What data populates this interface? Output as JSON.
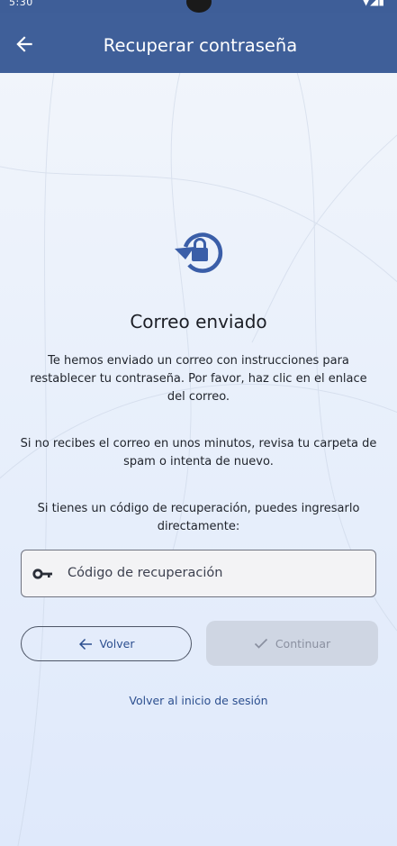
{
  "status_bar": {
    "time": "5:30",
    "icons": [
      "notification-icon",
      "location-icon",
      "shield-icon",
      "wifi-icon",
      "signal-icon",
      "battery-icon"
    ]
  },
  "app_bar": {
    "title": "Recuperar contraseña",
    "back_icon": "arrow-back-icon",
    "background_color": "#3f5f99"
  },
  "main": {
    "icon": "lock-reset-icon",
    "heading": "Correo enviado",
    "paragraph1": "Te hemos enviado un correo con instrucciones para restablecer tu contraseña. Por favor, haz clic en el enlace del correo.",
    "paragraph2": "Si no recibes el correo en unos minutos, revisa tu carpeta de spam o intenta de nuevo.",
    "paragraph3": "Si tienes un código de recuperación, puedes ingresarlo directamente:"
  },
  "code_input": {
    "icon": "key-icon",
    "placeholder": "Código de recuperación",
    "value": ""
  },
  "buttons": {
    "back_label": "Volver",
    "back_icon": "arrow-left-icon",
    "continue_label": "Continuar",
    "continue_icon": "check-icon",
    "continue_disabled": true
  },
  "links": {
    "back_to_login": "Volver al inicio de sesión"
  },
  "colors": {
    "primary": "#2c4f8f",
    "icon_blue": "#3a5ea8"
  }
}
